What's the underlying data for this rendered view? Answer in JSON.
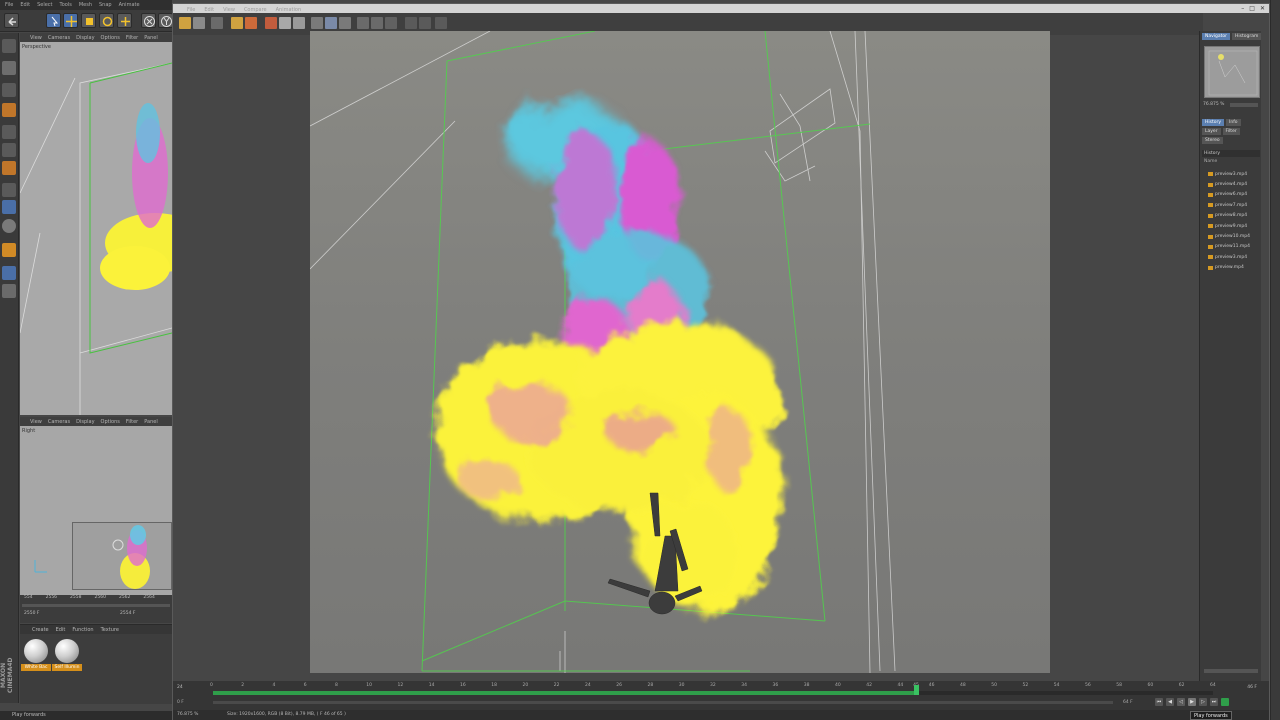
{
  "app": {
    "menu": [
      "File",
      "Edit",
      "Select",
      "Tools",
      "Mesh",
      "Snap",
      "Animate"
    ],
    "viewport_menu": [
      "View",
      "Cameras",
      "Display",
      "Options",
      "Filter",
      "Panel"
    ],
    "viewport_top_label": "Perspective",
    "viewport_right_label": "Right",
    "mini_timeline": {
      "ticks": [
        "554",
        "2556",
        "2558",
        "2560",
        "2562",
        "2564"
      ],
      "frame": "2550 F",
      "end_frame": "2554 F"
    },
    "material_menu": [
      "Create",
      "Edit",
      "Function",
      "Texture"
    ],
    "materials": [
      {
        "name": "White Bac"
      },
      {
        "name": "Self Illumin"
      }
    ],
    "logo": "MAXON CINEMA4D",
    "status": "Play forwards"
  },
  "picture_viewer": {
    "window_controls": [
      "–",
      "□",
      "✕"
    ],
    "menu": [
      "File",
      "Edit",
      "View",
      "Compare",
      "Animation"
    ],
    "navigator": {
      "tabs": [
        "Navigator",
        "Histogram"
      ],
      "zoom": "76.875 %"
    },
    "history": {
      "tabs_row1": [
        "History",
        "Info"
      ],
      "tabs_row2": [
        "Layer",
        "Filter"
      ],
      "tabs_row3": [
        "Stereo"
      ],
      "header": "History",
      "column": "Name",
      "items": [
        "preview3.mp4",
        "preview4.mp4",
        "preview6.mp4",
        "preview7.mp4",
        "preview8.mp4",
        "preview9.mp4",
        "preview10.mp4",
        "preview11.mp4",
        "preview3.mp4",
        "preview.mp4"
      ]
    },
    "timeline": {
      "start_label": "24",
      "ticks": [
        "0",
        "2",
        "4",
        "6",
        "8",
        "10",
        "12",
        "14",
        "16",
        "18",
        "20",
        "22",
        "24",
        "26",
        "28",
        "30",
        "32",
        "34",
        "36",
        "38",
        "40",
        "42",
        "44",
        "45",
        "46",
        "48",
        "50",
        "52",
        "54",
        "56",
        "58",
        "60",
        "62",
        "64"
      ],
      "current_frame": 45,
      "max_frame": 64,
      "current_label": "0 F",
      "fps_label": "46 F",
      "end_label": "64 F"
    },
    "status": {
      "zoom": "76.875 %",
      "info": "Size: 1920x1600, RGB (8 Bit), 8.79 MB,  ( F 46 of 65 )"
    },
    "tooltip": "Play forwards"
  },
  "colors": {
    "smoke_yellow": "#fbf23a",
    "smoke_magenta": "#e23fcf",
    "smoke_cyan": "#48c6e0",
    "guide_green": "#4fd34a",
    "timeline_green": "#2f9e4a",
    "material_label": "#d58f1a"
  }
}
